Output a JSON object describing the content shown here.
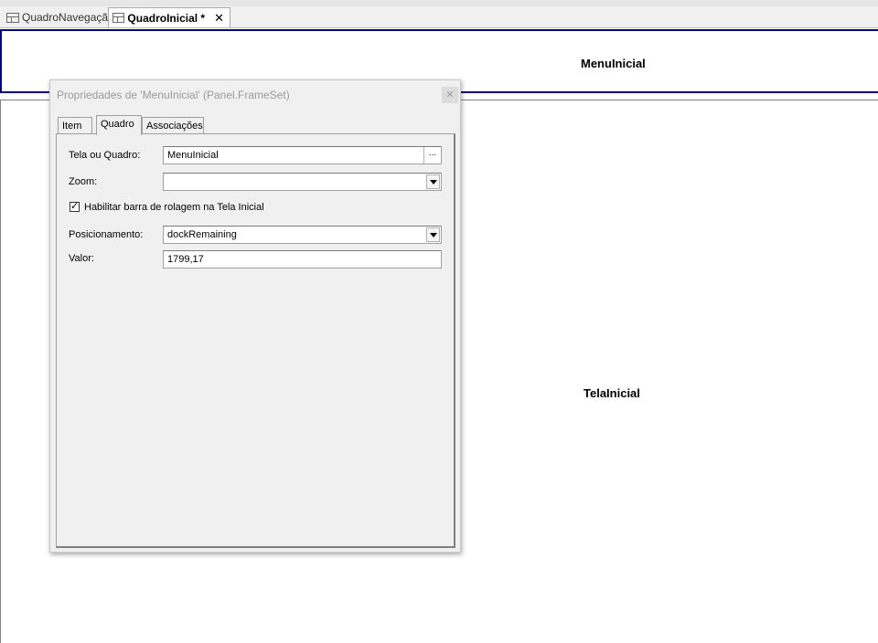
{
  "tabs": [
    {
      "label": "QuadroNavegação",
      "active": false
    },
    {
      "label": "QuadroInicial *",
      "active": true,
      "close": "✕"
    }
  ],
  "canvas": {
    "menu_frame_label": "MenuInicial",
    "main_frame_label": "TelaInicial"
  },
  "dialog": {
    "title": "Propriedades de 'MenuInicial' (Panel.FrameSet)",
    "close_glyph": "✕",
    "tabs": [
      "Item",
      "Quadro",
      "Associações"
    ],
    "active_tab": "Quadro",
    "fields": {
      "tela_label": "Tela ou Quadro:",
      "tela_value": "MenuInicial",
      "browse_label": "...",
      "zoom_label": "Zoom:",
      "zoom_value": "",
      "scroll_checkbox_label": "Habilitar barra de rolagem na Tela Inicial",
      "scroll_checked": true,
      "pos_label": "Posicionamento:",
      "pos_value": "dockRemaining",
      "valor_label": "Valor:",
      "valor_value": "1799,17"
    }
  },
  "colors": {
    "frame_border": "#00007f",
    "dialog_bg": "#f0f0f0",
    "title_text": "#9a9a9a"
  },
  "icons": [
    "frame-tab-icon",
    "close-icon",
    "chevron-down-icon",
    "checkbox-check-icon",
    "ellipsis-icon"
  ]
}
